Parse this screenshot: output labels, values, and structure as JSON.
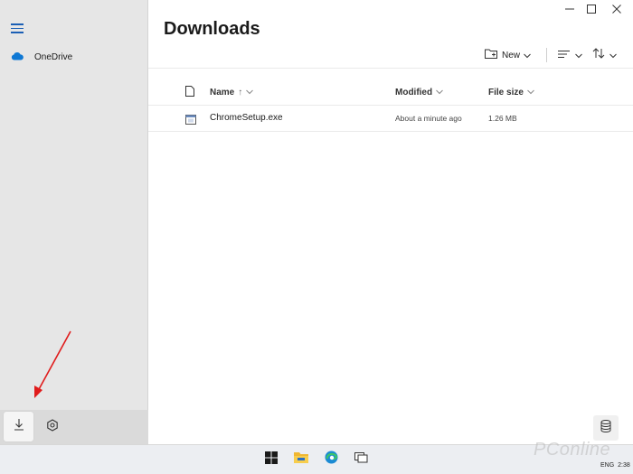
{
  "window": {
    "title": "Downloads"
  },
  "sidebar": {
    "menu_icon": "hamburger-icon",
    "items": [
      {
        "label": "OneDrive",
        "icon": "cloud-icon"
      }
    ],
    "bottom": {
      "downloads_icon": "download-icon",
      "settings_icon": "gear-icon"
    }
  },
  "toolbar": {
    "new_label": "New"
  },
  "table": {
    "columns": [
      "Name",
      "Modified",
      "File size"
    ],
    "sort_indicator": "↑",
    "rows": [
      {
        "name": "ChromeSetup.exe",
        "modified": "About a minute ago",
        "size": "1.26 MB"
      }
    ]
  },
  "tray": {
    "lang": "ENG",
    "time": "2:38"
  },
  "watermark": "PConline",
  "colors": {
    "accent": "#1b5fb5",
    "onedrive": "#0f78d4",
    "annotation": "#e01b1b"
  }
}
